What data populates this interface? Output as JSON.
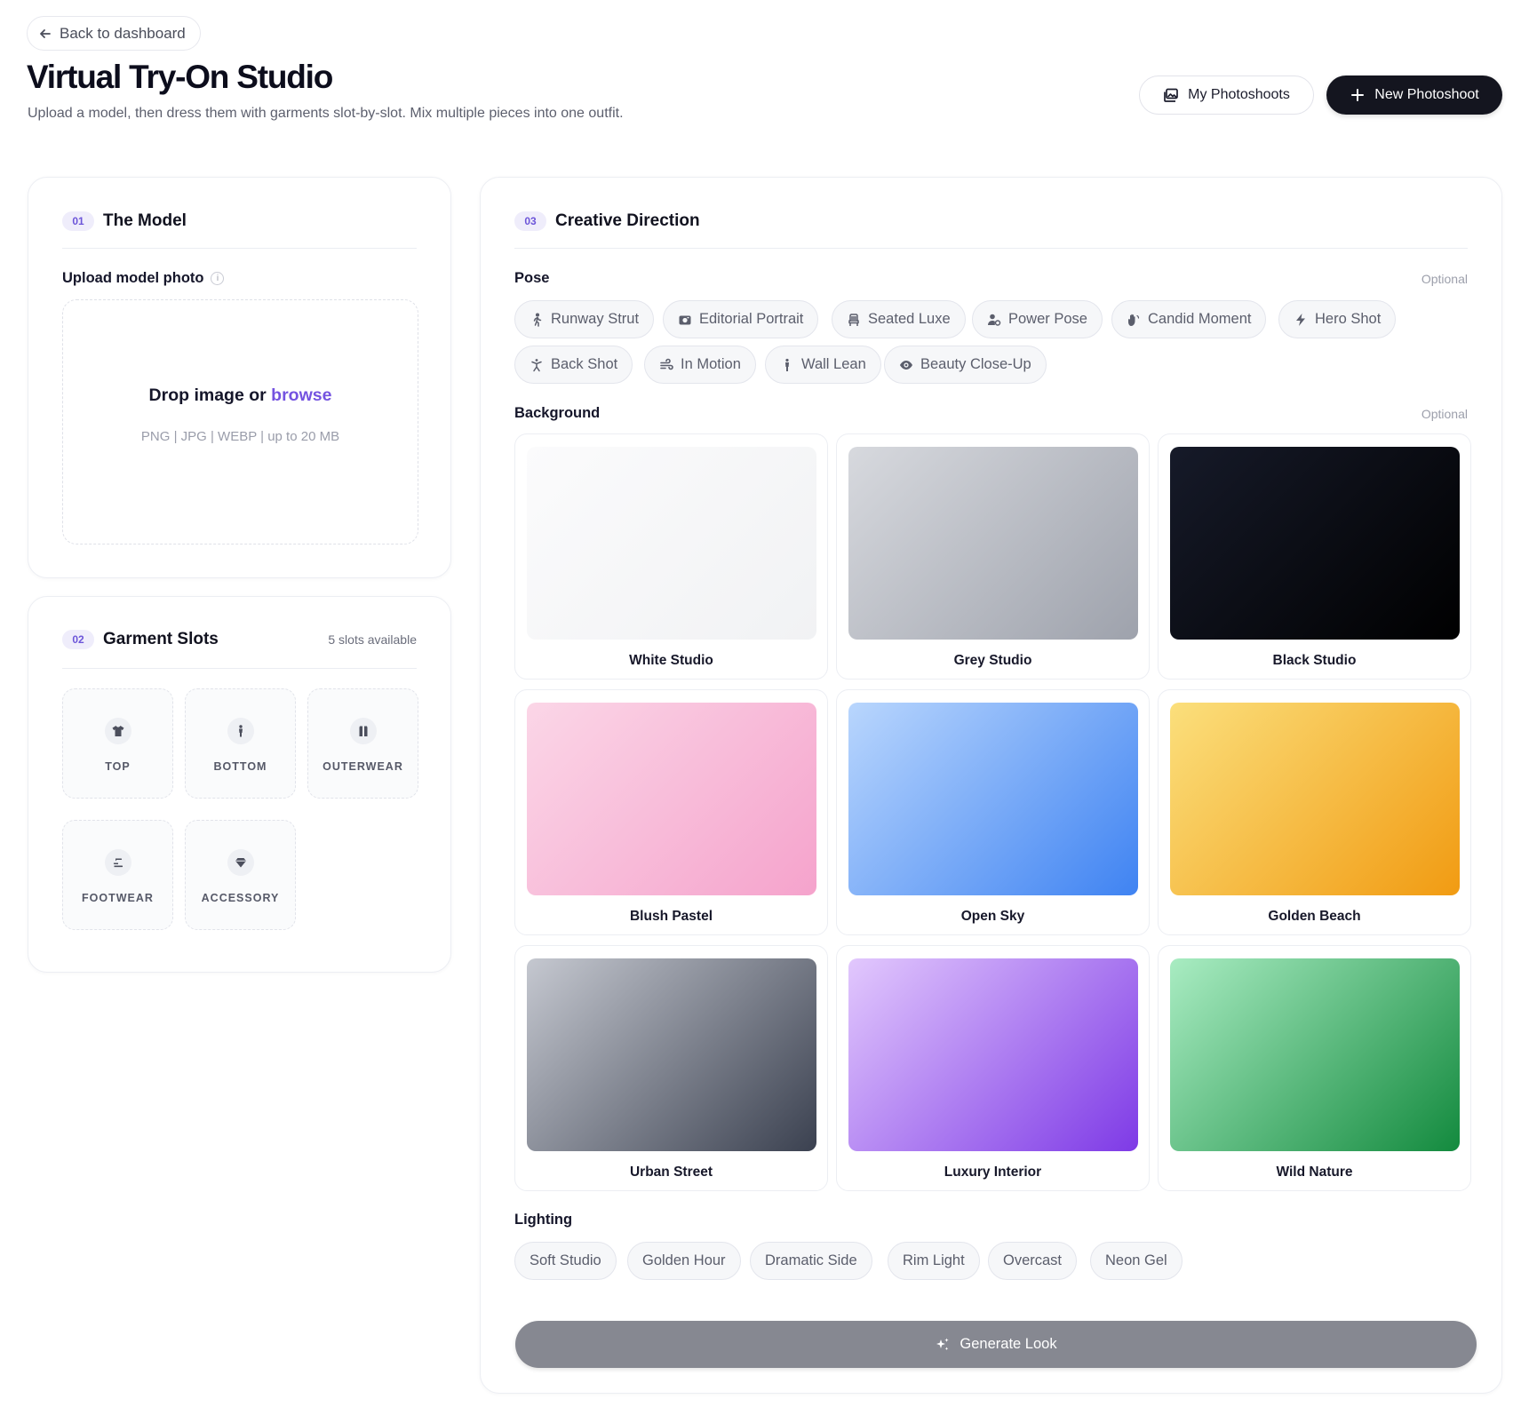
{
  "header": {
    "back_label": "Back to dashboard",
    "title": "Virtual Try-On Studio",
    "subtitle": "Upload a model, then dress them with garments slot-by-slot. Mix multiple pieces into one outfit.",
    "my_photoshoots_label": "My Photoshoots",
    "new_photoshoot_label": "New Photoshoot"
  },
  "model_card": {
    "step": "01",
    "title": "The Model",
    "upload_label": "Upload model photo",
    "info_icon": "i",
    "drop_text": "Drop image or ",
    "drop_link": "browse",
    "drop_hint": "PNG | JPG | WEBP | up to 20 MB"
  },
  "garment_card": {
    "step": "02",
    "title": "Garment Slots",
    "availability": "5 slots available",
    "slots": [
      {
        "label": "TOP",
        "icon": "shirt-icon"
      },
      {
        "label": "BOTTOM",
        "icon": "person-icon"
      },
      {
        "label": "OUTERWEAR",
        "icon": "jacket-icon"
      },
      {
        "label": "FOOTWEAR",
        "icon": "shoe-icon"
      },
      {
        "label": "ACCESSORY",
        "icon": "gem-icon"
      }
    ]
  },
  "creative_card": {
    "step": "03",
    "title": "Creative Direction",
    "optional_label": "Optional",
    "pose_label": "Pose",
    "poses": [
      {
        "label": "Runway Strut",
        "icon": "walking-icon"
      },
      {
        "label": "Editorial Portrait",
        "icon": "camera-icon"
      },
      {
        "label": "Seated Luxe",
        "icon": "chair-icon"
      },
      {
        "label": "Power Pose",
        "icon": "user-cog-icon"
      },
      {
        "label": "Candid Moment",
        "icon": "hand-icon"
      },
      {
        "label": "Hero Shot",
        "icon": "bolt-icon"
      },
      {
        "label": "Back Shot",
        "icon": "figure-back-icon"
      },
      {
        "label": "In Motion",
        "icon": "wind-icon"
      },
      {
        "label": "Wall Lean",
        "icon": "person-standing-icon"
      },
      {
        "label": "Beauty Close-Up",
        "icon": "eye-icon"
      }
    ],
    "background_label": "Background",
    "backgrounds": [
      {
        "label": "White Studio",
        "colors": [
          "#fbfbfc",
          "#f1f2f4"
        ]
      },
      {
        "label": "Grey Studio",
        "colors": [
          "#d7d9de",
          "#9ea2ac"
        ]
      },
      {
        "label": "Black Studio",
        "colors": [
          "#161a29",
          "#000000"
        ]
      },
      {
        "label": "Blush Pastel",
        "colors": [
          "#fbd6e7",
          "#f5a3cc"
        ]
      },
      {
        "label": "Open Sky",
        "colors": [
          "#b9d6fd",
          "#3f83f2"
        ]
      },
      {
        "label": "Golden Beach",
        "colors": [
          "#fbdf7c",
          "#f19b12"
        ]
      },
      {
        "label": "Urban Street",
        "colors": [
          "#c5c8d0",
          "#3b4150"
        ]
      },
      {
        "label": "Luxury Interior",
        "colors": [
          "#e2c8fd",
          "#7e3ae6"
        ]
      },
      {
        "label": "Wild Nature",
        "colors": [
          "#a9ecc2",
          "#138a3e"
        ]
      }
    ],
    "lighting_label": "Lighting",
    "lighting": [
      "Soft Studio",
      "Golden Hour",
      "Dramatic Side",
      "Rim Light",
      "Overcast",
      "Neon Gel"
    ],
    "generate_label": "Generate Look"
  }
}
